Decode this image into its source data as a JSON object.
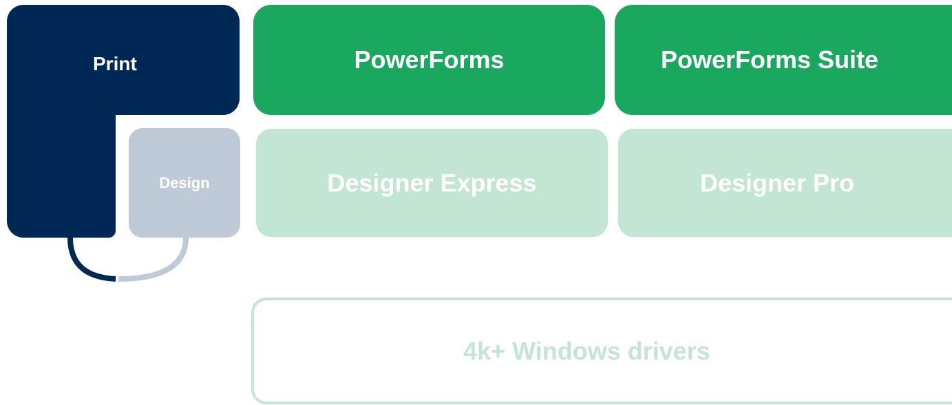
{
  "blocks": {
    "print": "Print",
    "design": "Design",
    "powerforms": "PowerForms",
    "powerforms_suite": "PowerForms Suite",
    "designer_express": "Designer Express",
    "designer_pro": "Designer Pro",
    "drivers": "4k+ Windows drivers"
  },
  "colors": {
    "navy": "#002855",
    "grey": "#bfcad8",
    "green": "#1aa85e",
    "light_green": "#c3e6d4",
    "white": "#ffffff"
  }
}
